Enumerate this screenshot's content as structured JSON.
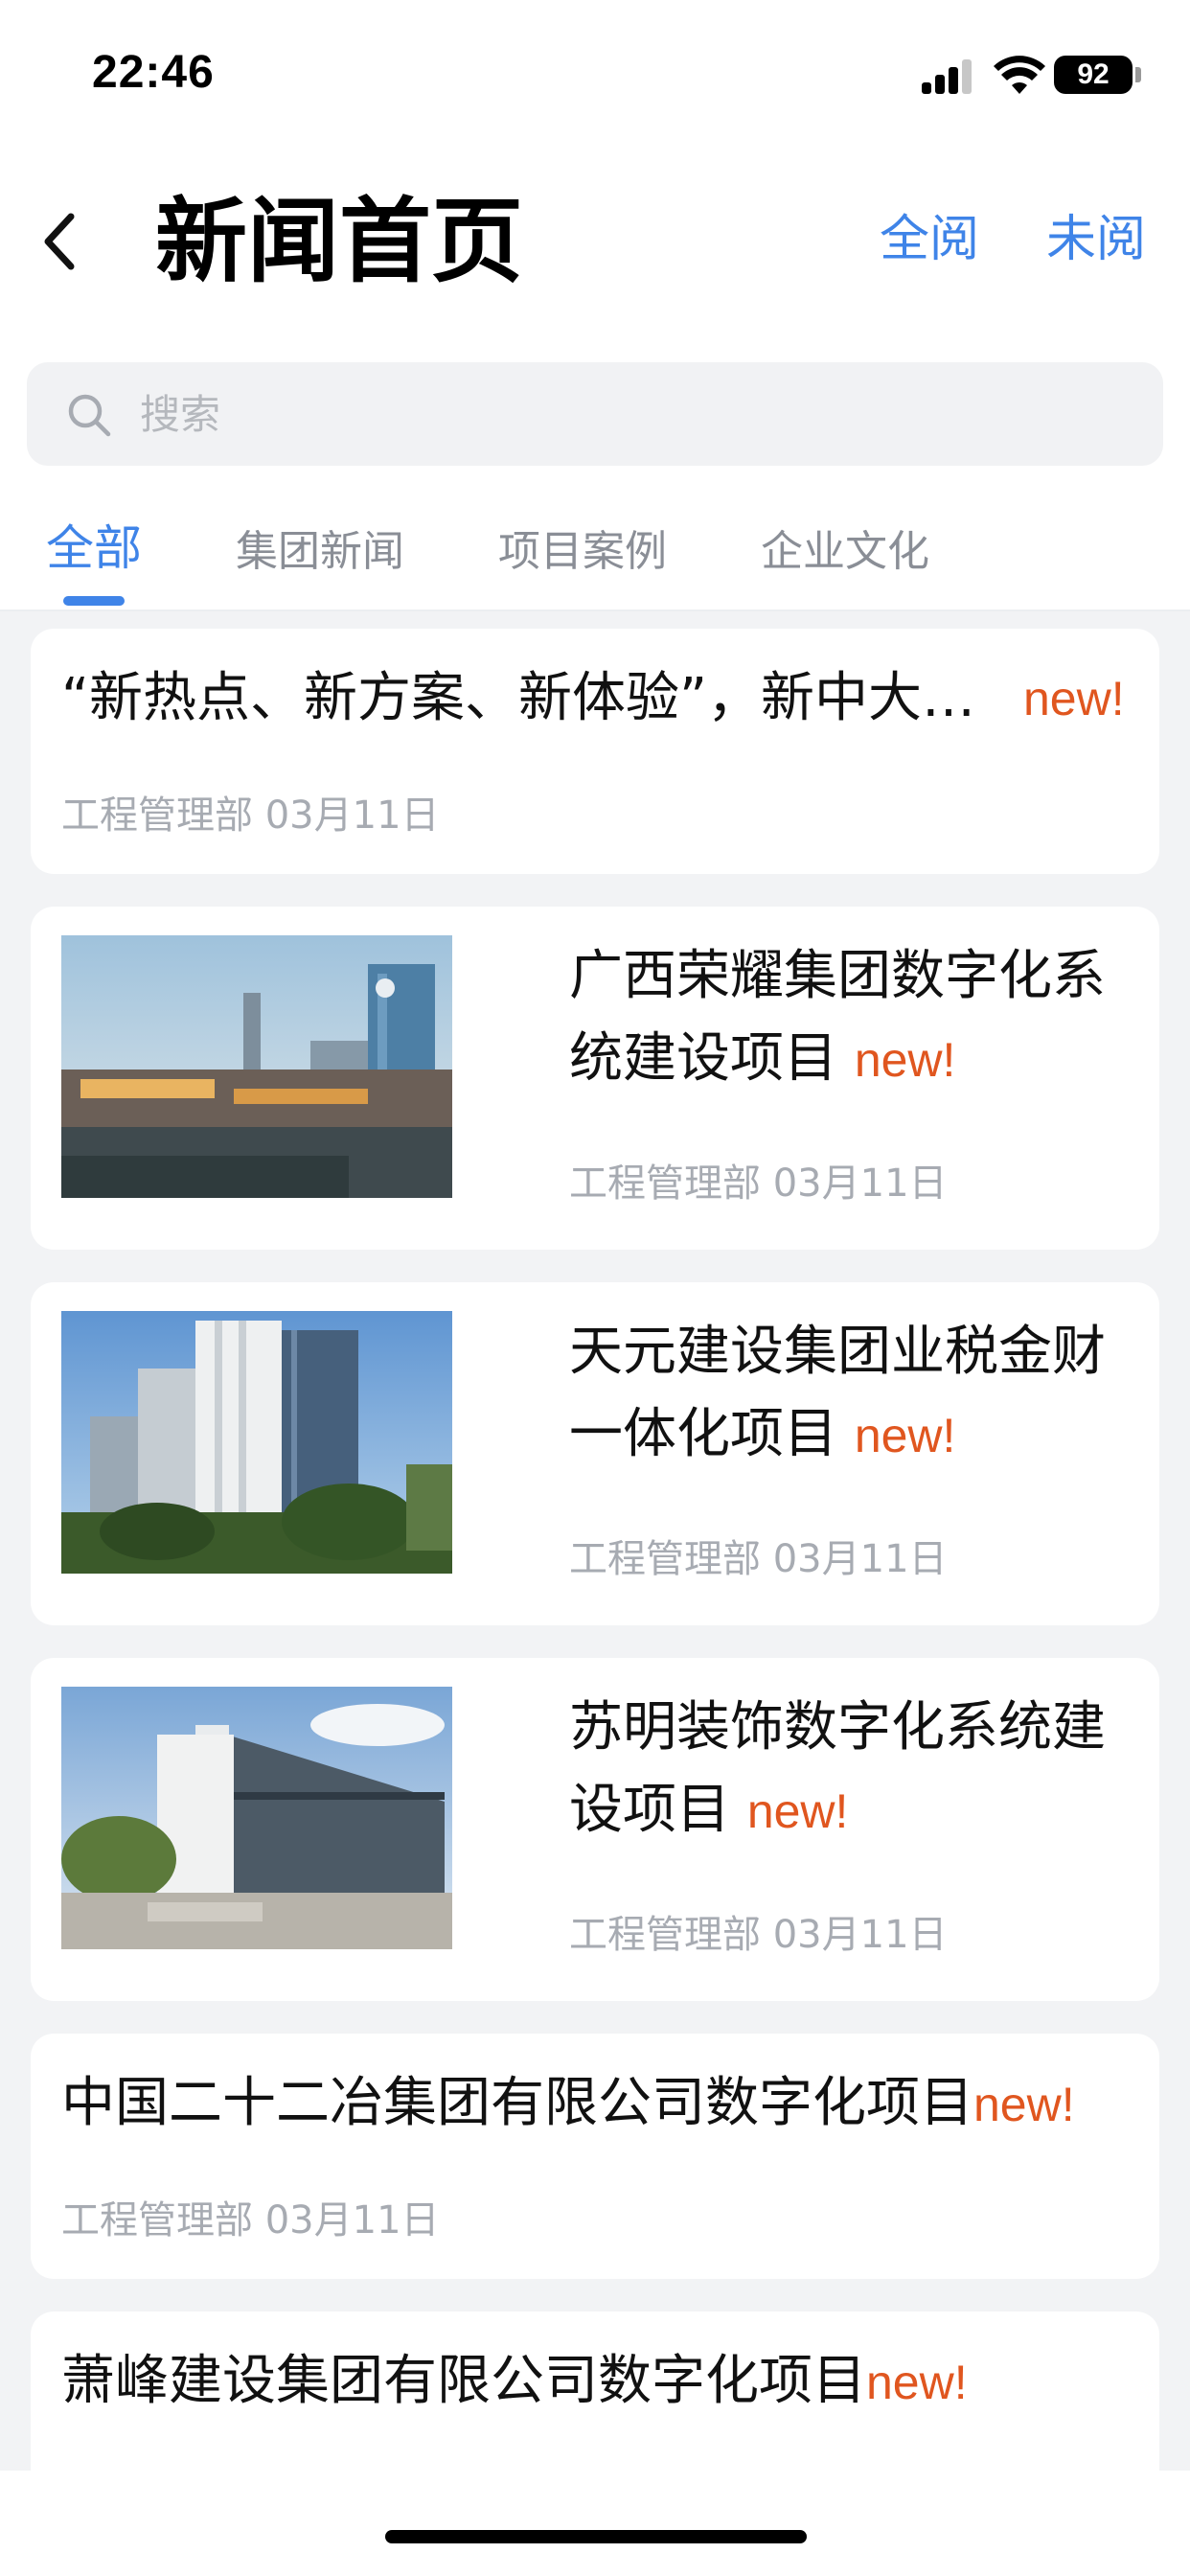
{
  "status_bar": {
    "time": "22:46",
    "battery": "92"
  },
  "header": {
    "title": "新闻首页",
    "read_all": "全阅",
    "unread": "未阅"
  },
  "search": {
    "placeholder": "搜索"
  },
  "tabs": [
    {
      "label": "全部",
      "active": true
    },
    {
      "label": "集团新闻",
      "active": false
    },
    {
      "label": "项目案例",
      "active": false
    },
    {
      "label": "企业文化",
      "active": false
    }
  ],
  "news": [
    {
      "title": "“新热点、新方案、新体验”，新中大…",
      "badge": "new!",
      "dept": "工程管理部",
      "date": "03月11日",
      "has_image": false
    },
    {
      "title_line1": "广西荣耀集团数字化系",
      "title_line2": "统建设项目",
      "badge": "new!",
      "dept": "工程管理部",
      "date": "03月11日",
      "has_image": true,
      "image": "city-skyline"
    },
    {
      "title_line1": "天元建设集团业税金财",
      "title_line2": "一体化项目",
      "badge": "new!",
      "dept": "工程管理部",
      "date": "03月11日",
      "has_image": true,
      "image": "office-tower"
    },
    {
      "title_line1": "苏明装饰数字化系统建",
      "title_line2": "设项目",
      "badge": "new!",
      "dept": "工程管理部",
      "date": "03月11日",
      "has_image": true,
      "image": "modern-building"
    },
    {
      "title": "中国二十二冶集团有限公司数字化项目",
      "badge": "new!",
      "dept": "工程管理部",
      "date": "03月11日",
      "has_image": false
    },
    {
      "title": "萧峰建设集团有限公司数字化项目",
      "badge": "new!",
      "has_image": false
    }
  ],
  "colors": {
    "accent": "#3f84e8",
    "new_badge": "#e0561f",
    "meta": "#a7abb2",
    "background": "#f2f3f5"
  }
}
